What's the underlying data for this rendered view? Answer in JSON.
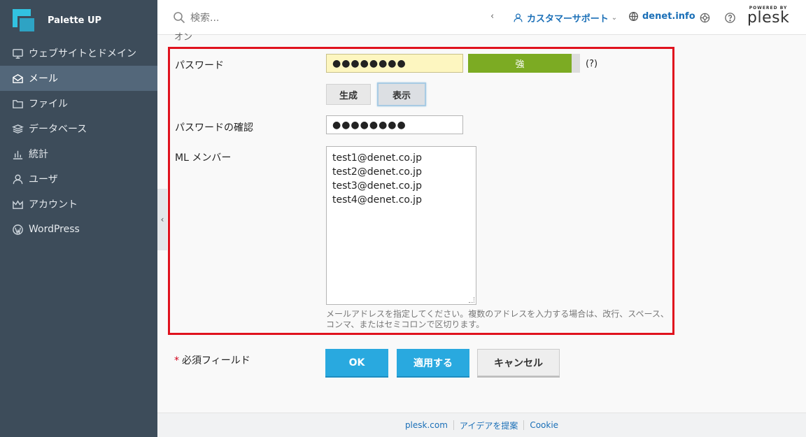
{
  "brand": {
    "name": "Palette UP"
  },
  "sidebar": {
    "items": [
      {
        "label": "ウェブサイトとドメイン",
        "icon": "monitor-icon",
        "active": false
      },
      {
        "label": "メール",
        "icon": "mail-icon",
        "active": true
      },
      {
        "label": "ファイル",
        "icon": "folder-icon",
        "active": false
      },
      {
        "label": "データベース",
        "icon": "database-icon",
        "active": false
      },
      {
        "label": "統計",
        "icon": "bar-chart-icon",
        "active": false
      },
      {
        "label": "ユーザ",
        "icon": "user-icon",
        "active": false
      },
      {
        "label": "アカウント",
        "icon": "crown-icon",
        "active": false
      },
      {
        "label": "WordPress",
        "icon": "wordpress-icon",
        "active": false
      }
    ]
  },
  "header": {
    "search_placeholder": "検索...",
    "user_label": "カスタマーサポート",
    "domain_label": "denet.info",
    "powered_by": "POWERED BY",
    "plesk": "plesk"
  },
  "form": {
    "cut_label": "オン",
    "password_label": "パスワード",
    "password_value": "●●●●●●●●",
    "strength_label": "強",
    "strength_color": "#7cab23",
    "help_label": "(?)",
    "generate_label": "生成",
    "show_label": "表示",
    "confirm_label": "パスワードの確認",
    "confirm_value": "●●●●●●●●",
    "members_label": "ML メンバー",
    "members": [
      "test1@denet.co.jp",
      "test2@denet.co.jp",
      "test3@denet.co.jp",
      "test4@denet.co.jp"
    ],
    "hint": "メールアドレスを指定してください。複数のアドレスを入力する場合は、改行、スペース、コンマ、またはセミコロンで区切ります。",
    "required_star": "*",
    "required_label": "必須フィールド",
    "ok_label": "OK",
    "apply_label": "適用する",
    "cancel_label": "キャンセル"
  },
  "footer": {
    "links": [
      "plesk.com",
      "アイデアを提案",
      "Cookie"
    ]
  },
  "colors": {
    "accent": "#29a9df",
    "sidebar": "#3d4c5a",
    "highlight_box": "#e0121e"
  }
}
